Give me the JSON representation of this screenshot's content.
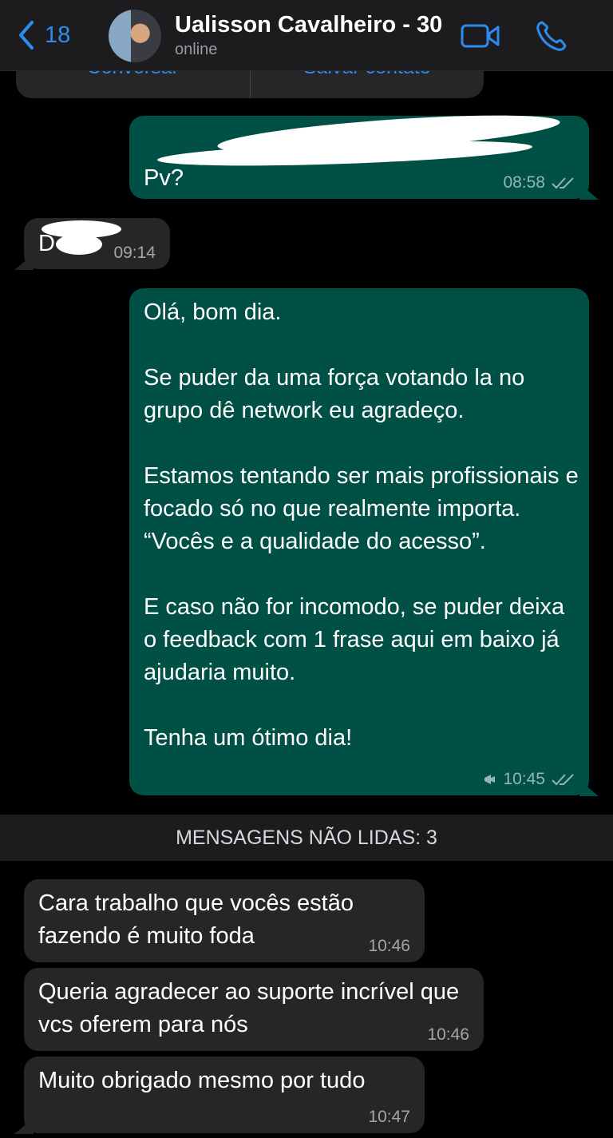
{
  "header": {
    "back_count": "18",
    "contact_name": "Ualisson Cavalheiro - 30",
    "status": "online",
    "icons": {
      "back": "chevron-left-icon",
      "video": "video-camera-icon",
      "call": "phone-icon",
      "avatar": "contact-avatar"
    }
  },
  "contact_card": {
    "actions": [
      "Conversar",
      "Salvar contato"
    ]
  },
  "messages": [
    {
      "direction": "outgoing",
      "text": "Pv?",
      "time": "08:58",
      "status_icon": "double-check-icon"
    },
    {
      "direction": "incoming",
      "text": "D",
      "time": "09:14"
    },
    {
      "direction": "outgoing",
      "text": "Olá, bom dia.\n\nSe puder da uma força votando la no grupo dê network eu agradeço.\n\nEstamos tentando ser mais profissionais e focado só no que realmente importa. “Vocês e a qualidade do acesso”.\n\nE caso não for incomodo, se puder deixa o feedback com 1 frase aqui em baixo já ajudaria muito.\n\nTenha um ótimo dia!",
      "time": "10:45",
      "status_icon": "double-check-icon",
      "extra_icon": "broadcast-megaphone-icon"
    }
  ],
  "unread_banner": "MENSAGENS NÃO LIDAS: 3",
  "unread_messages": [
    {
      "direction": "incoming",
      "text": "Cara trabalho que vocês estão fazendo é muito foda",
      "time": "10:46"
    },
    {
      "direction": "incoming",
      "text": "Queria agradecer ao suporte incrível que vcs oferem para nós",
      "time": "10:46"
    },
    {
      "direction": "incoming",
      "text": "Muito obrigado mesmo por tudo",
      "time": "10:47"
    }
  ],
  "colors": {
    "accent": "#2d8cf0",
    "outgoing_bubble": "#005046",
    "incoming_bubble": "#262628",
    "background": "#000000"
  }
}
